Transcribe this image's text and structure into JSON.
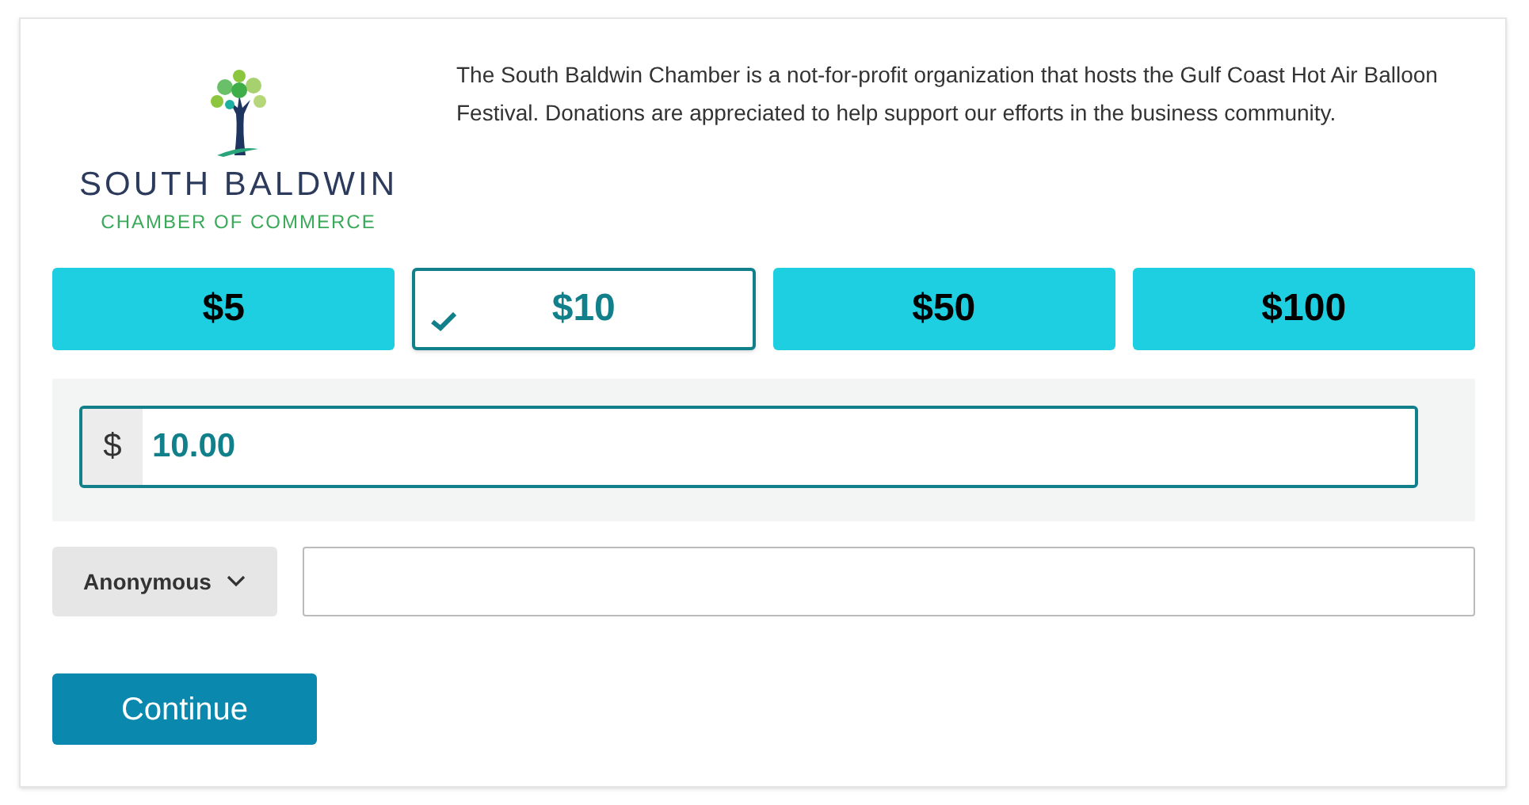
{
  "logo": {
    "name": "SOUTH BALDWIN",
    "subtitle": "CHAMBER OF COMMERCE"
  },
  "description": "The South Baldwin Chamber is a not-for-profit organization that hosts the Gulf Coast Hot Air Balloon Festival. Donations are appreciated to help support our efforts in the business community.",
  "amounts": [
    {
      "label": "$5",
      "selected": false
    },
    {
      "label": "$10",
      "selected": true
    },
    {
      "label": "$50",
      "selected": false
    },
    {
      "label": "$100",
      "selected": false
    }
  ],
  "amount_field": {
    "prefix": "$",
    "value": "10.00"
  },
  "name_select": {
    "value": "Anonymous"
  },
  "continue_button": "Continue"
}
